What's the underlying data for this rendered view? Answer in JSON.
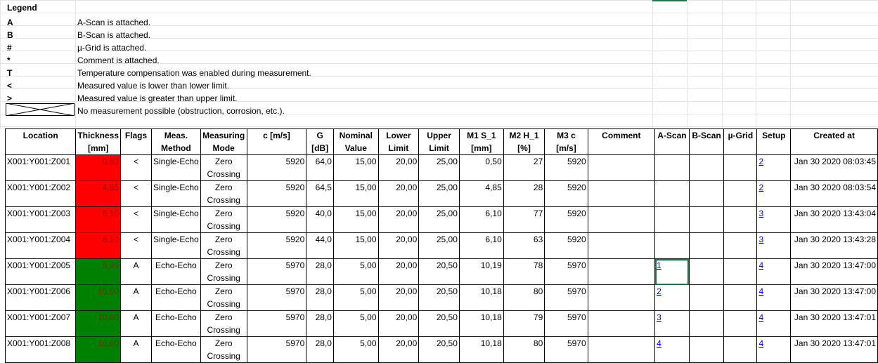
{
  "legend": {
    "title": "Legend",
    "items": [
      {
        "symbol": "A",
        "text": "A-Scan is attached."
      },
      {
        "symbol": "B",
        "text": "B-Scan is attached."
      },
      {
        "symbol": "#",
        "text": "µ-Grid is attached."
      },
      {
        "symbol": "*",
        "text": "Comment is attached."
      },
      {
        "symbol": "T",
        "text": "Temperature compensation was enabled during measurement."
      },
      {
        "symbol": "<",
        "text": "Measured value is lower than lower limit."
      },
      {
        "symbol": ">",
        "text": "Measured value is greater than upper limit."
      },
      {
        "symbol": "",
        "text": "No measurement possible (obstruction, corrosion, etc.)."
      }
    ]
  },
  "table": {
    "headers": [
      {
        "l1": "Location",
        "l2": ""
      },
      {
        "l1": "Thickness",
        "l2": "[mm]"
      },
      {
        "l1": "Flags",
        "l2": ""
      },
      {
        "l1": "Meas.",
        "l2": "Method"
      },
      {
        "l1": "Measuring",
        "l2": "Mode"
      },
      {
        "l1": "c [m/s]",
        "l2": ""
      },
      {
        "l1": "G",
        "l2": "[dB]"
      },
      {
        "l1": "Nominal",
        "l2": "Value"
      },
      {
        "l1": "Lower",
        "l2": "Limit"
      },
      {
        "l1": "Upper",
        "l2": "Limit"
      },
      {
        "l1": "M1 S_1",
        "l2": "[mm]"
      },
      {
        "l1": "M2 H_1",
        "l2": "[%]"
      },
      {
        "l1": "M3 c",
        "l2": "[m/s]"
      },
      {
        "l1": "Comment",
        "l2": ""
      },
      {
        "l1": "A-Scan",
        "l2": ""
      },
      {
        "l1": "B-Scan",
        "l2": ""
      },
      {
        "l1": "µ-Grid",
        "l2": ""
      },
      {
        "l1": "Setup",
        "l2": ""
      },
      {
        "l1": "Created at",
        "l2": ""
      }
    ],
    "rows": [
      {
        "location": "X001:Y001:Z001",
        "thickness": "0,50",
        "status": "red",
        "flags": "<",
        "method": "Single-Echo",
        "mode1": "Zero",
        "mode2": "Crossing",
        "c": "5920",
        "g": "64,0",
        "nominal": "15,00",
        "lower": "20,00",
        "upper": "25,00",
        "m1": "0,50",
        "m2": "27",
        "m3": "5920",
        "comment": "",
        "ascan": "",
        "bscan": "",
        "mugrid": "",
        "setup": "2",
        "created": "Jan 30 2020 08:03:45"
      },
      {
        "location": "X001:Y001:Z002",
        "thickness": "4,85",
        "status": "red",
        "flags": "<",
        "method": "Single-Echo",
        "mode1": "Zero",
        "mode2": "Crossing",
        "c": "5920",
        "g": "64,5",
        "nominal": "15,00",
        "lower": "20,00",
        "upper": "25,00",
        "m1": "4,85",
        "m2": "28",
        "m3": "5920",
        "comment": "",
        "ascan": "",
        "bscan": "",
        "mugrid": "",
        "setup": "2",
        "created": "Jan 30 2020 08:03:54"
      },
      {
        "location": "X001:Y001:Z003",
        "thickness": "6,10",
        "status": "red",
        "flags": "<",
        "method": "Single-Echo",
        "mode1": "Zero",
        "mode2": "Crossing",
        "c": "5920",
        "g": "40,0",
        "nominal": "15,00",
        "lower": "20,00",
        "upper": "25,00",
        "m1": "6,10",
        "m2": "77",
        "m3": "5920",
        "comment": "",
        "ascan": "",
        "bscan": "",
        "mugrid": "",
        "setup": "3",
        "created": "Jan 30 2020 13:43:04"
      },
      {
        "location": "X001:Y001:Z004",
        "thickness": "6,10",
        "status": "red",
        "flags": "<",
        "method": "Single-Echo",
        "mode1": "Zero",
        "mode2": "Crossing",
        "c": "5920",
        "g": "44,0",
        "nominal": "15,00",
        "lower": "20,00",
        "upper": "25,00",
        "m1": "6,10",
        "m2": "63",
        "m3": "5920",
        "comment": "",
        "ascan": "",
        "bscan": "",
        "mugrid": "",
        "setup": "3",
        "created": "Jan 30 2020 13:43:28"
      },
      {
        "location": "X001:Y001:Z005",
        "thickness": "9,99",
        "status": "green",
        "flags": "A",
        "method": "Echo-Echo",
        "mode1": "Zero",
        "mode2": "Crossing",
        "c": "5970",
        "g": "28,0",
        "nominal": "5,00",
        "lower": "20,00",
        "upper": "20,50",
        "m1": "10,19",
        "m2": "78",
        "m3": "5970",
        "comment": "",
        "ascan": "1",
        "bscan": "",
        "mugrid": "",
        "setup": "4",
        "created": "Jan 30 2020 13:47:00"
      },
      {
        "location": "X001:Y001:Z006",
        "thickness": "10,00",
        "status": "green",
        "flags": "A",
        "method": "Echo-Echo",
        "mode1": "Zero",
        "mode2": "Crossing",
        "c": "5970",
        "g": "28,0",
        "nominal": "5,00",
        "lower": "20,00",
        "upper": "20,50",
        "m1": "10,18",
        "m2": "80",
        "m3": "5970",
        "comment": "",
        "ascan": "2",
        "bscan": "",
        "mugrid": "",
        "setup": "4",
        "created": "Jan 30 2020 13:47:00"
      },
      {
        "location": "X001:Y001:Z007",
        "thickness": "10,00",
        "status": "green",
        "flags": "A",
        "method": "Echo-Echo",
        "mode1": "Zero",
        "mode2": "Crossing",
        "c": "5970",
        "g": "28,0",
        "nominal": "5,00",
        "lower": "20,00",
        "upper": "20,50",
        "m1": "10,18",
        "m2": "79",
        "m3": "5970",
        "comment": "",
        "ascan": "3",
        "bscan": "",
        "mugrid": "",
        "setup": "4",
        "created": "Jan 30 2020 13:47:01"
      },
      {
        "location": "X001:Y001:Z008",
        "thickness": "10,00",
        "status": "green",
        "flags": "A",
        "method": "Echo-Echo",
        "mode1": "Zero",
        "mode2": "Crossing",
        "c": "5970",
        "g": "28,0",
        "nominal": "5,00",
        "lower": "20,00",
        "upper": "20,50",
        "m1": "10,18",
        "m2": "80",
        "m3": "5970",
        "comment": "",
        "ascan": "4",
        "bscan": "",
        "mugrid": "",
        "setup": "4",
        "created": "Jan 30 2020 13:47:01"
      }
    ]
  }
}
